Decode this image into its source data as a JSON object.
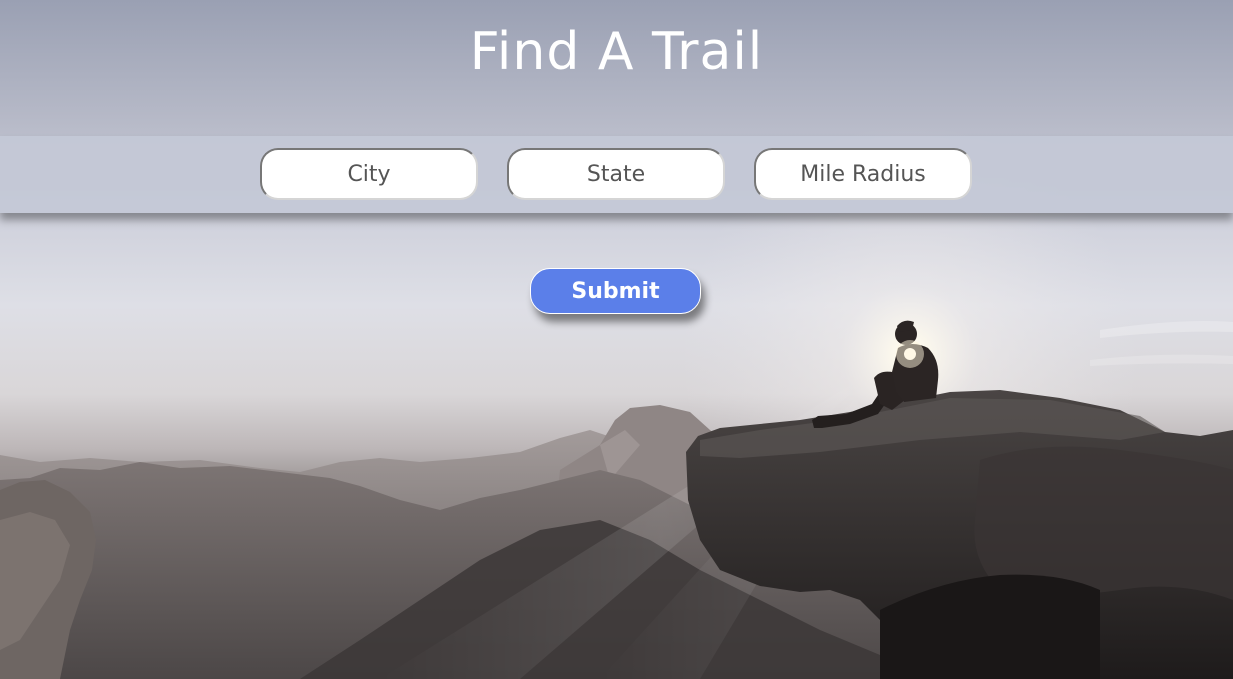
{
  "page": {
    "title": "Find A Trail"
  },
  "search": {
    "city_placeholder": "City",
    "state_placeholder": "State",
    "radius_placeholder": "Mile Radius"
  },
  "actions": {
    "submit_label": "Submit"
  },
  "background": {
    "subject": "hiker sitting on cliff edge at sunset over mountains"
  },
  "colors": {
    "accent": "#5b7fe9",
    "bar": "#c4c8d6",
    "title_text": "#ffffff"
  }
}
